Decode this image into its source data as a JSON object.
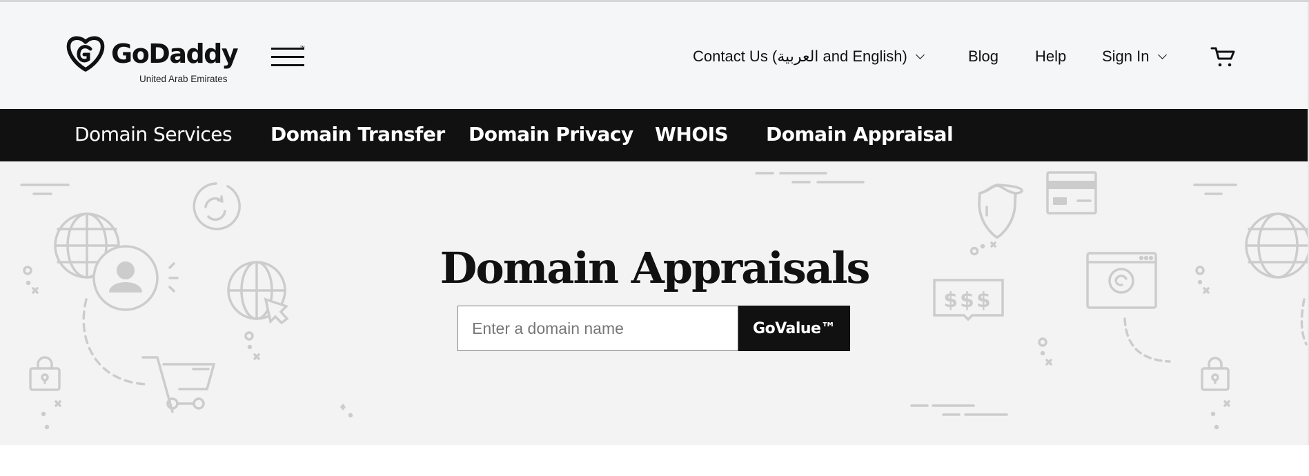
{
  "header": {
    "brand": "GoDaddy",
    "brand_tm": "™",
    "region": "United Arab Emirates",
    "utility_nav": [
      {
        "label": "Contact Us (العربية and English)",
        "has_dropdown": true
      },
      {
        "label": "Blog",
        "has_dropdown": false
      },
      {
        "label": "Help",
        "has_dropdown": false
      },
      {
        "label": "Sign In",
        "has_dropdown": true
      }
    ],
    "icons": {
      "menu": "hamburger-icon",
      "cart": "cart-icon"
    }
  },
  "nav": {
    "items": [
      {
        "label": "Domain Services"
      },
      {
        "label": "Domain Transfer"
      },
      {
        "label": "Domain Privacy"
      },
      {
        "label": "WHOIS"
      },
      {
        "label": "Domain Appraisal"
      }
    ]
  },
  "hero": {
    "title": "Domain Appraisals",
    "search_placeholder": "Enter a domain name",
    "search_value": "",
    "button_label": "GoValue™"
  },
  "colors": {
    "header_bg": "#f5f6f8",
    "nav_bg": "#111111",
    "hero_bg": "#f3f3f3",
    "illustration": "#cccccc",
    "text": "#111111"
  }
}
